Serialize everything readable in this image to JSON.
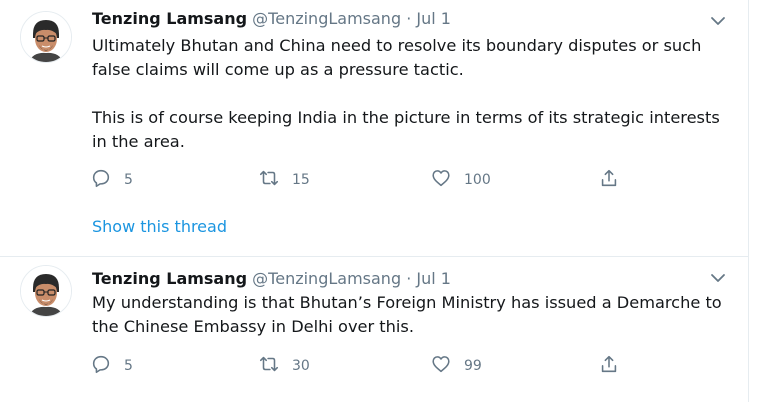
{
  "tweets": [
    {
      "author": {
        "name": "Tenzing Lamsang",
        "handle": "@TenzingLamsang"
      },
      "separator": "·",
      "date": "Jul 1",
      "paragraphs": [
        "Ultimately Bhutan and China need to resolve its boundary disputes or such false claims will come up as a pressure tactic.",
        "This is of course keeping India in the picture in terms of its strategic interests in the area."
      ],
      "counts": {
        "replies": "5",
        "retweets": "15",
        "likes": "100"
      },
      "show_thread_label": "Show this thread"
    },
    {
      "author": {
        "name": "Tenzing Lamsang",
        "handle": "@TenzingLamsang"
      },
      "separator": "·",
      "date": "Jul 1",
      "paragraphs": [
        "My understanding is that Bhutan’s Foreign Ministry has issued a Demarche to the Chinese Embassy in Delhi over this."
      ],
      "counts": {
        "replies": "5",
        "retweets": "30",
        "likes": "99"
      }
    }
  ],
  "icons": {
    "reply": "reply-icon",
    "retweet": "retweet-icon",
    "like": "heart-icon",
    "share": "share-icon",
    "menu": "chevron-down-icon"
  },
  "colors": {
    "accent": "#1b95e0",
    "secondary_text": "#657786",
    "divider": "#e6ecf0"
  }
}
